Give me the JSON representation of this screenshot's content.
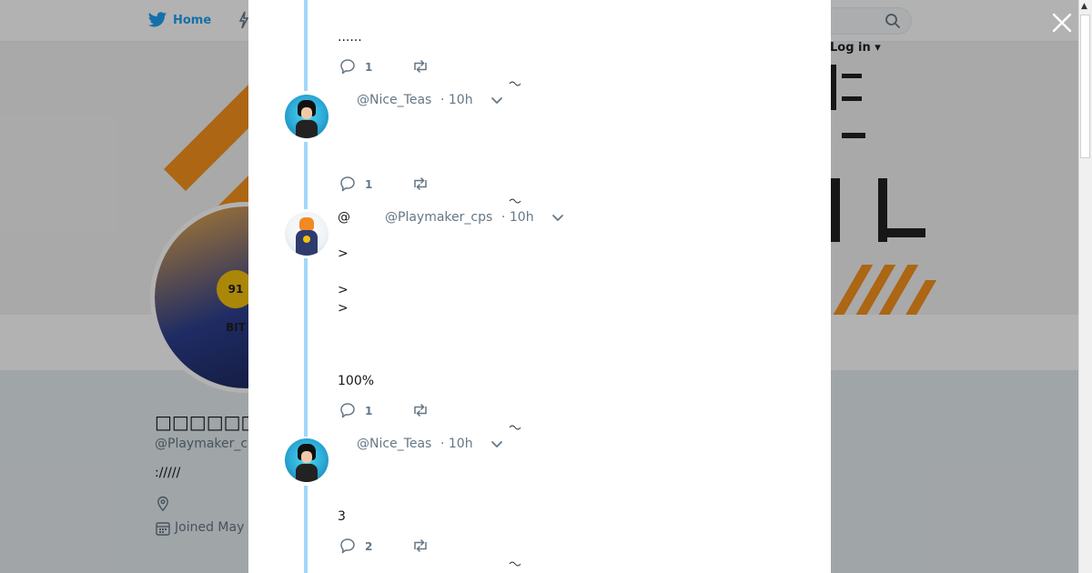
{
  "nav": {
    "home_label": "Home",
    "login_label": "Log in"
  },
  "profile": {
    "name": "□□□□□□□□@",
    "handle": "@Playmaker_c",
    "bio": "://///",
    "joined": "Joined May",
    "avatar_badge": "91 BIT"
  },
  "tweets": [
    {
      "handle": "",
      "time": "",
      "lines": [
        "......"
      ],
      "reply_count": "1"
    },
    {
      "handle": "@Nice_Teas",
      "time": "· 10h",
      "lines": [],
      "reply_count": "1"
    },
    {
      "handle": "@Playmaker_cps",
      "time": "· 10h",
      "at_prefix": "@",
      "lines": [
        ">",
        ">",
        ">",
        "100%"
      ],
      "reply_count": "1"
    },
    {
      "handle": "@Nice_Teas",
      "time": "· 10h",
      "lines": [
        "3"
      ],
      "reply_count": "2"
    }
  ],
  "icons": {
    "close": "close-icon",
    "reply": "reply-icon",
    "retweet": "retweet-icon",
    "caret": "chevron-down-icon",
    "twitter": "twitter-bird-icon",
    "search": "search-icon",
    "location": "location-icon",
    "calendar": "calendar-icon"
  },
  "colors": {
    "accent": "#1da1f2",
    "thread_line": "#a3d7fa",
    "muted_text": "#657786",
    "banner_orange": "#f7931e"
  }
}
